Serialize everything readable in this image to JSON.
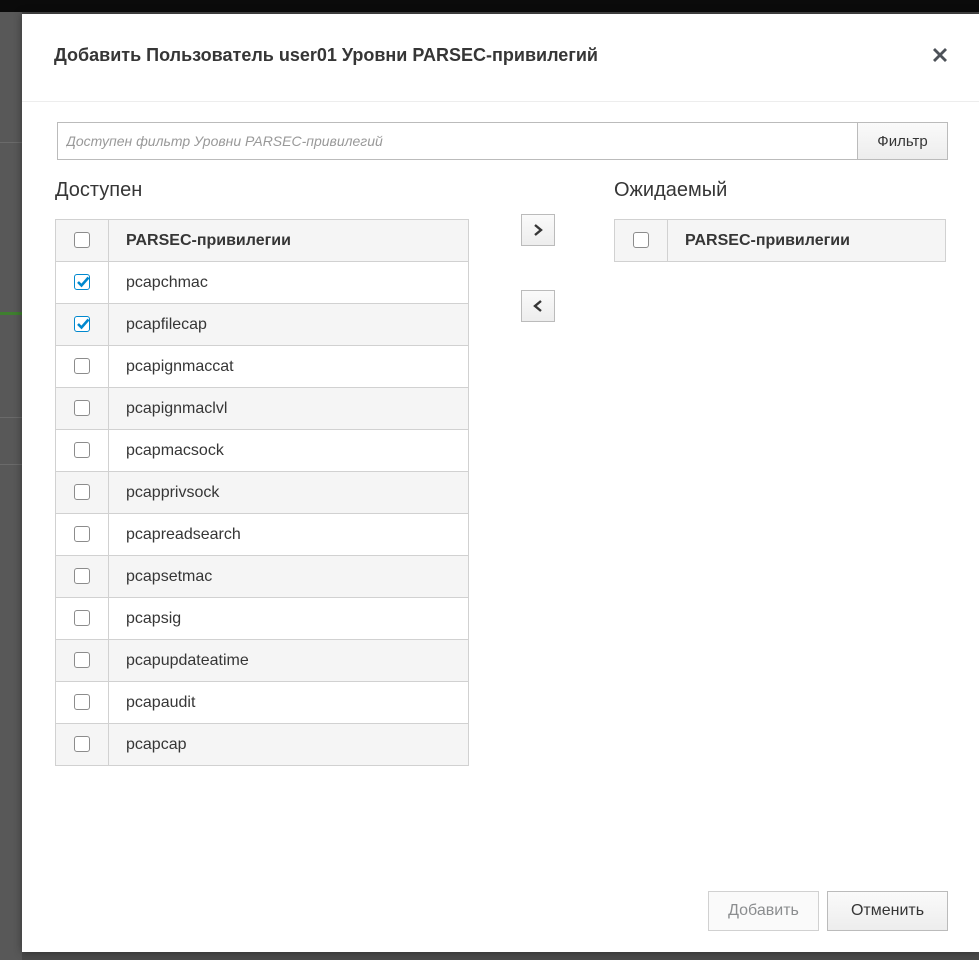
{
  "modal": {
    "title": "Добавить Пользователь user01 Уровни PARSEC-привилегий",
    "close_icon": "close-icon"
  },
  "filter": {
    "placeholder": "Доступен фильтр Уровни PARSEC-привилегий",
    "value": "",
    "button_label": "Фильтр"
  },
  "available": {
    "label": "Доступен",
    "column_header": "PARSEC-привилегии",
    "header_checked": false,
    "rows": [
      {
        "name": "pcapchmac",
        "checked": true
      },
      {
        "name": "pcapfilecap",
        "checked": true
      },
      {
        "name": "pcapignmaccat",
        "checked": false
      },
      {
        "name": "pcapignmaclvl",
        "checked": false
      },
      {
        "name": "pcapmacsock",
        "checked": false
      },
      {
        "name": "pcapprivsock",
        "checked": false
      },
      {
        "name": "pcapreadsearch",
        "checked": false
      },
      {
        "name": "pcapsetmac",
        "checked": false
      },
      {
        "name": "pcapsig",
        "checked": false
      },
      {
        "name": "pcapupdateatime",
        "checked": false
      },
      {
        "name": "pcapaudit",
        "checked": false
      },
      {
        "name": "pcapcap",
        "checked": false
      }
    ]
  },
  "pending": {
    "label": "Ожидаемый",
    "column_header": "PARSEC-привилегии",
    "header_checked": false,
    "rows": []
  },
  "move_buttons": {
    "right_icon": "chevron-right-icon",
    "left_icon": "chevron-left-icon"
  },
  "footer": {
    "add_label": "Добавить",
    "add_disabled": true,
    "cancel_label": "Отменить"
  },
  "colors": {
    "checkbox_accent": "#0088ce",
    "text": "#363636",
    "border": "#d1d1d1"
  }
}
